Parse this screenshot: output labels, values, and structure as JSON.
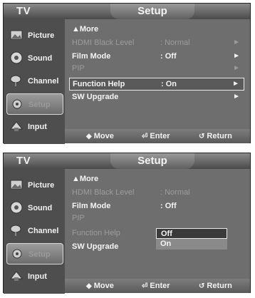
{
  "screens": [
    {
      "tv_label": "TV",
      "title": "Setup",
      "sidebar": [
        {
          "label": "Picture",
          "icon": "picture-icon"
        },
        {
          "label": "Sound",
          "icon": "sound-icon"
        },
        {
          "label": "Channel",
          "icon": "channel-icon"
        },
        {
          "label": "Setup",
          "icon": "setup-icon"
        },
        {
          "label": "Input",
          "icon": "input-icon"
        }
      ],
      "menu": [
        {
          "label": "▲More",
          "value": "",
          "arrow": ""
        },
        {
          "label": "HDMI Black Level",
          "value": ": Normal",
          "arrow": "►"
        },
        {
          "label": "Film Mode",
          "value": ": Off",
          "arrow": "►"
        },
        {
          "label": "PIP",
          "value": "",
          "arrow": "►"
        },
        {
          "label": "Function Help",
          "value": ": On",
          "arrow": "►"
        },
        {
          "label": "SW Upgrade",
          "value": "",
          "arrow": "►"
        }
      ],
      "bottom": {
        "move": "Move",
        "enter": "Enter",
        "return": "Return"
      }
    },
    {
      "tv_label": "TV",
      "title": "Setup",
      "sidebar": [
        {
          "label": "Picture",
          "icon": "picture-icon"
        },
        {
          "label": "Sound",
          "icon": "sound-icon"
        },
        {
          "label": "Channel",
          "icon": "channel-icon"
        },
        {
          "label": "Setup",
          "icon": "setup-icon"
        },
        {
          "label": "Input",
          "icon": "input-icon"
        }
      ],
      "menu": [
        {
          "label": "▲More",
          "value": ""
        },
        {
          "label": "HDMI Black Level",
          "value": ": Normal"
        },
        {
          "label": "Film Mode",
          "value": ": Off"
        },
        {
          "label": "PIP",
          "value": ""
        },
        {
          "label": "Function Help",
          "value": ":"
        },
        {
          "label": "SW Upgrade",
          "value": ""
        }
      ],
      "dropdown": {
        "options": [
          "Off",
          "On"
        ],
        "selected": "Off"
      },
      "bottom": {
        "move": "Move",
        "enter": "Enter",
        "return": "Return"
      }
    }
  ]
}
